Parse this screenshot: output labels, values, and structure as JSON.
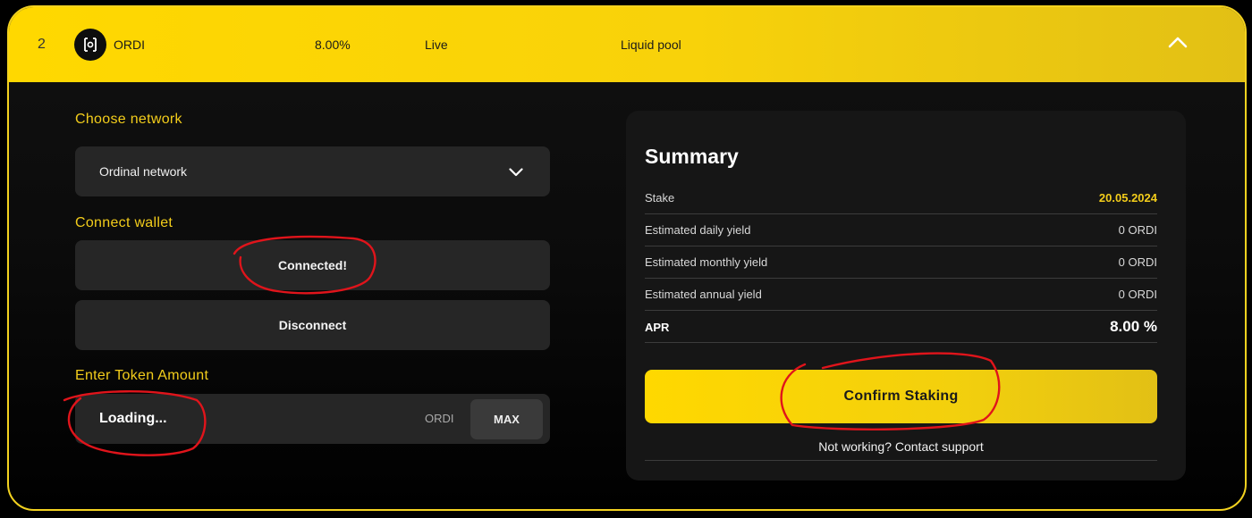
{
  "header": {
    "index": "2",
    "token_name": "ORDI",
    "apr": "8.00%",
    "status": "Live",
    "pool_type": "Liquid pool",
    "collapse_icon": "chevron-up-icon",
    "token_icon": "ordi-logo-icon"
  },
  "network": {
    "label": "Choose network",
    "selected": "Ordinal network",
    "dropdown_icon": "chevron-down-icon"
  },
  "wallet": {
    "label": "Connect wallet",
    "connected_label": "Connected!",
    "disconnect_label": "Disconnect"
  },
  "amount": {
    "label": "Enter Token Amount",
    "value": "Loading...",
    "unit": "ORDI",
    "max_label": "MAX"
  },
  "summary": {
    "title": "Summary",
    "rows": [
      {
        "label": "Stake",
        "value": "20.05.2024"
      },
      {
        "label": "Estimated daily yield",
        "value": "0 ORDI"
      },
      {
        "label": "Estimated monthly yield",
        "value": "0 ORDI"
      },
      {
        "label": "Estimated annual yield",
        "value": "0 ORDI"
      },
      {
        "label": "APR",
        "value": "8.00 %"
      }
    ],
    "confirm_label": "Confirm Staking",
    "support_label": "Not working? Contact support"
  },
  "colors": {
    "accent": "#ffd800",
    "label_gold": "#f3cd1b",
    "annotation_red": "#e0141b",
    "panel": "#262626"
  }
}
